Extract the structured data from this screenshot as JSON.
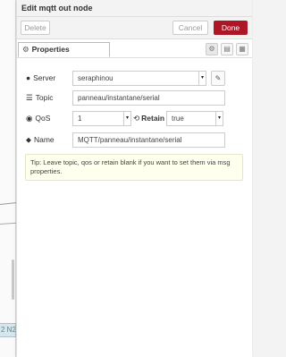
{
  "workspace": {
    "node_label": "2 N2"
  },
  "tray": {
    "title": "Edit mqtt out node",
    "delete_label": "Delete",
    "cancel_label": "Cancel",
    "done_label": "Done"
  },
  "tabs": {
    "properties_label": "Properties",
    "icons": [
      "gear-icon",
      "description-icon",
      "appearance-icon"
    ]
  },
  "form": {
    "server": {
      "label": "Server",
      "value": "seraphinou",
      "icon": "globe-icon"
    },
    "topic": {
      "label": "Topic",
      "value": "panneau/instantane/serial",
      "icon": "tasks-icon"
    },
    "qos": {
      "label": "QoS",
      "value": "1",
      "icon": "dot-circle-icon"
    },
    "retain": {
      "label": "Retain",
      "value": "true",
      "icon": "history-icon"
    },
    "name": {
      "label": "Name",
      "value": "MQTT/panneau/instantane/serial",
      "icon": "tag-icon"
    }
  },
  "tip": "Tip: Leave topic, qos or retain blank if you want to set them via msg properties.",
  "colors": {
    "done": "#ad1625",
    "tip_bg": "#ffffee"
  }
}
